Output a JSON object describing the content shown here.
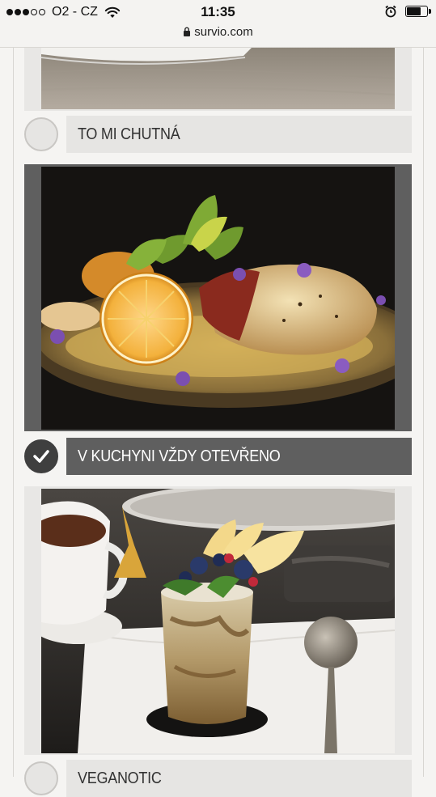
{
  "status_bar": {
    "carrier": "O2 - CZ",
    "time": "11:35",
    "url": "survio.com",
    "battery_level": 0.75
  },
  "options": [
    {
      "label": "TO MI CHUTNÁ",
      "selected": false
    },
    {
      "label": "V KUCHYNI VŽDY OTEVŘENO",
      "selected": true
    },
    {
      "label": "VEGANOTIC",
      "selected": false
    }
  ],
  "icons": [
    "signal-dots-icon",
    "wifi-icon",
    "lock-icon",
    "alarm-icon",
    "battery-icon",
    "checkmark-icon"
  ],
  "colors": {
    "selected": "#5f5f5f",
    "unselected": "#e6e5e3",
    "checked_radio": "#3f3f3f"
  }
}
